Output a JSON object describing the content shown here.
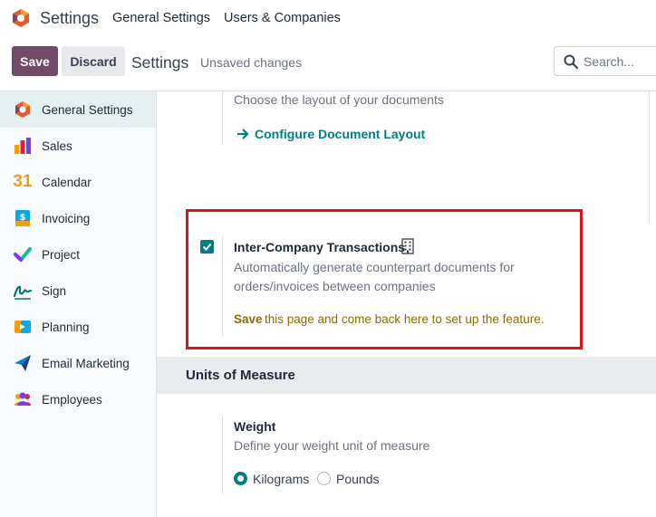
{
  "topbar": {
    "app_title": "Settings",
    "menu": [
      "General Settings",
      "Users & Companies"
    ]
  },
  "controlbar": {
    "save_label": "Save",
    "discard_label": "Discard",
    "title": "Settings",
    "status": "Unsaved changes",
    "search_placeholder": "Search..."
  },
  "sidebar": {
    "items": [
      {
        "label": "General Settings",
        "icon": "settings-app-icon",
        "active": true
      },
      {
        "label": "Sales",
        "icon": "sales-icon"
      },
      {
        "label": "Calendar",
        "icon": "calendar-icon"
      },
      {
        "label": "Invoicing",
        "icon": "invoicing-icon"
      },
      {
        "label": "Project",
        "icon": "project-icon"
      },
      {
        "label": "Sign",
        "icon": "sign-icon"
      },
      {
        "label": "Planning",
        "icon": "planning-icon"
      },
      {
        "label": "Email Marketing",
        "icon": "email-marketing-icon"
      },
      {
        "label": "Employees",
        "icon": "employees-icon"
      }
    ],
    "calendar_number": "31"
  },
  "main": {
    "layout": {
      "description": "Choose the layout of your documents",
      "link": "Configure Document Layout"
    },
    "inter_company": {
      "title": "Inter-Company Transactions",
      "checked": true,
      "description_line1": "Automatically generate counterpart documents for",
      "description_line2": "orders/invoices between companies",
      "save_word": "Save",
      "save_hint": "this page and come back here to set up the feature."
    },
    "uom_section": {
      "title": "Units of Measure",
      "weight_title": "Weight",
      "weight_description": "Define your weight unit of measure",
      "options": [
        "Kilograms",
        "Pounds"
      ],
      "selected": "Kilograms"
    }
  },
  "colors": {
    "primary": "#714B67",
    "accent": "#017e84",
    "highlight": "#e3121a"
  }
}
